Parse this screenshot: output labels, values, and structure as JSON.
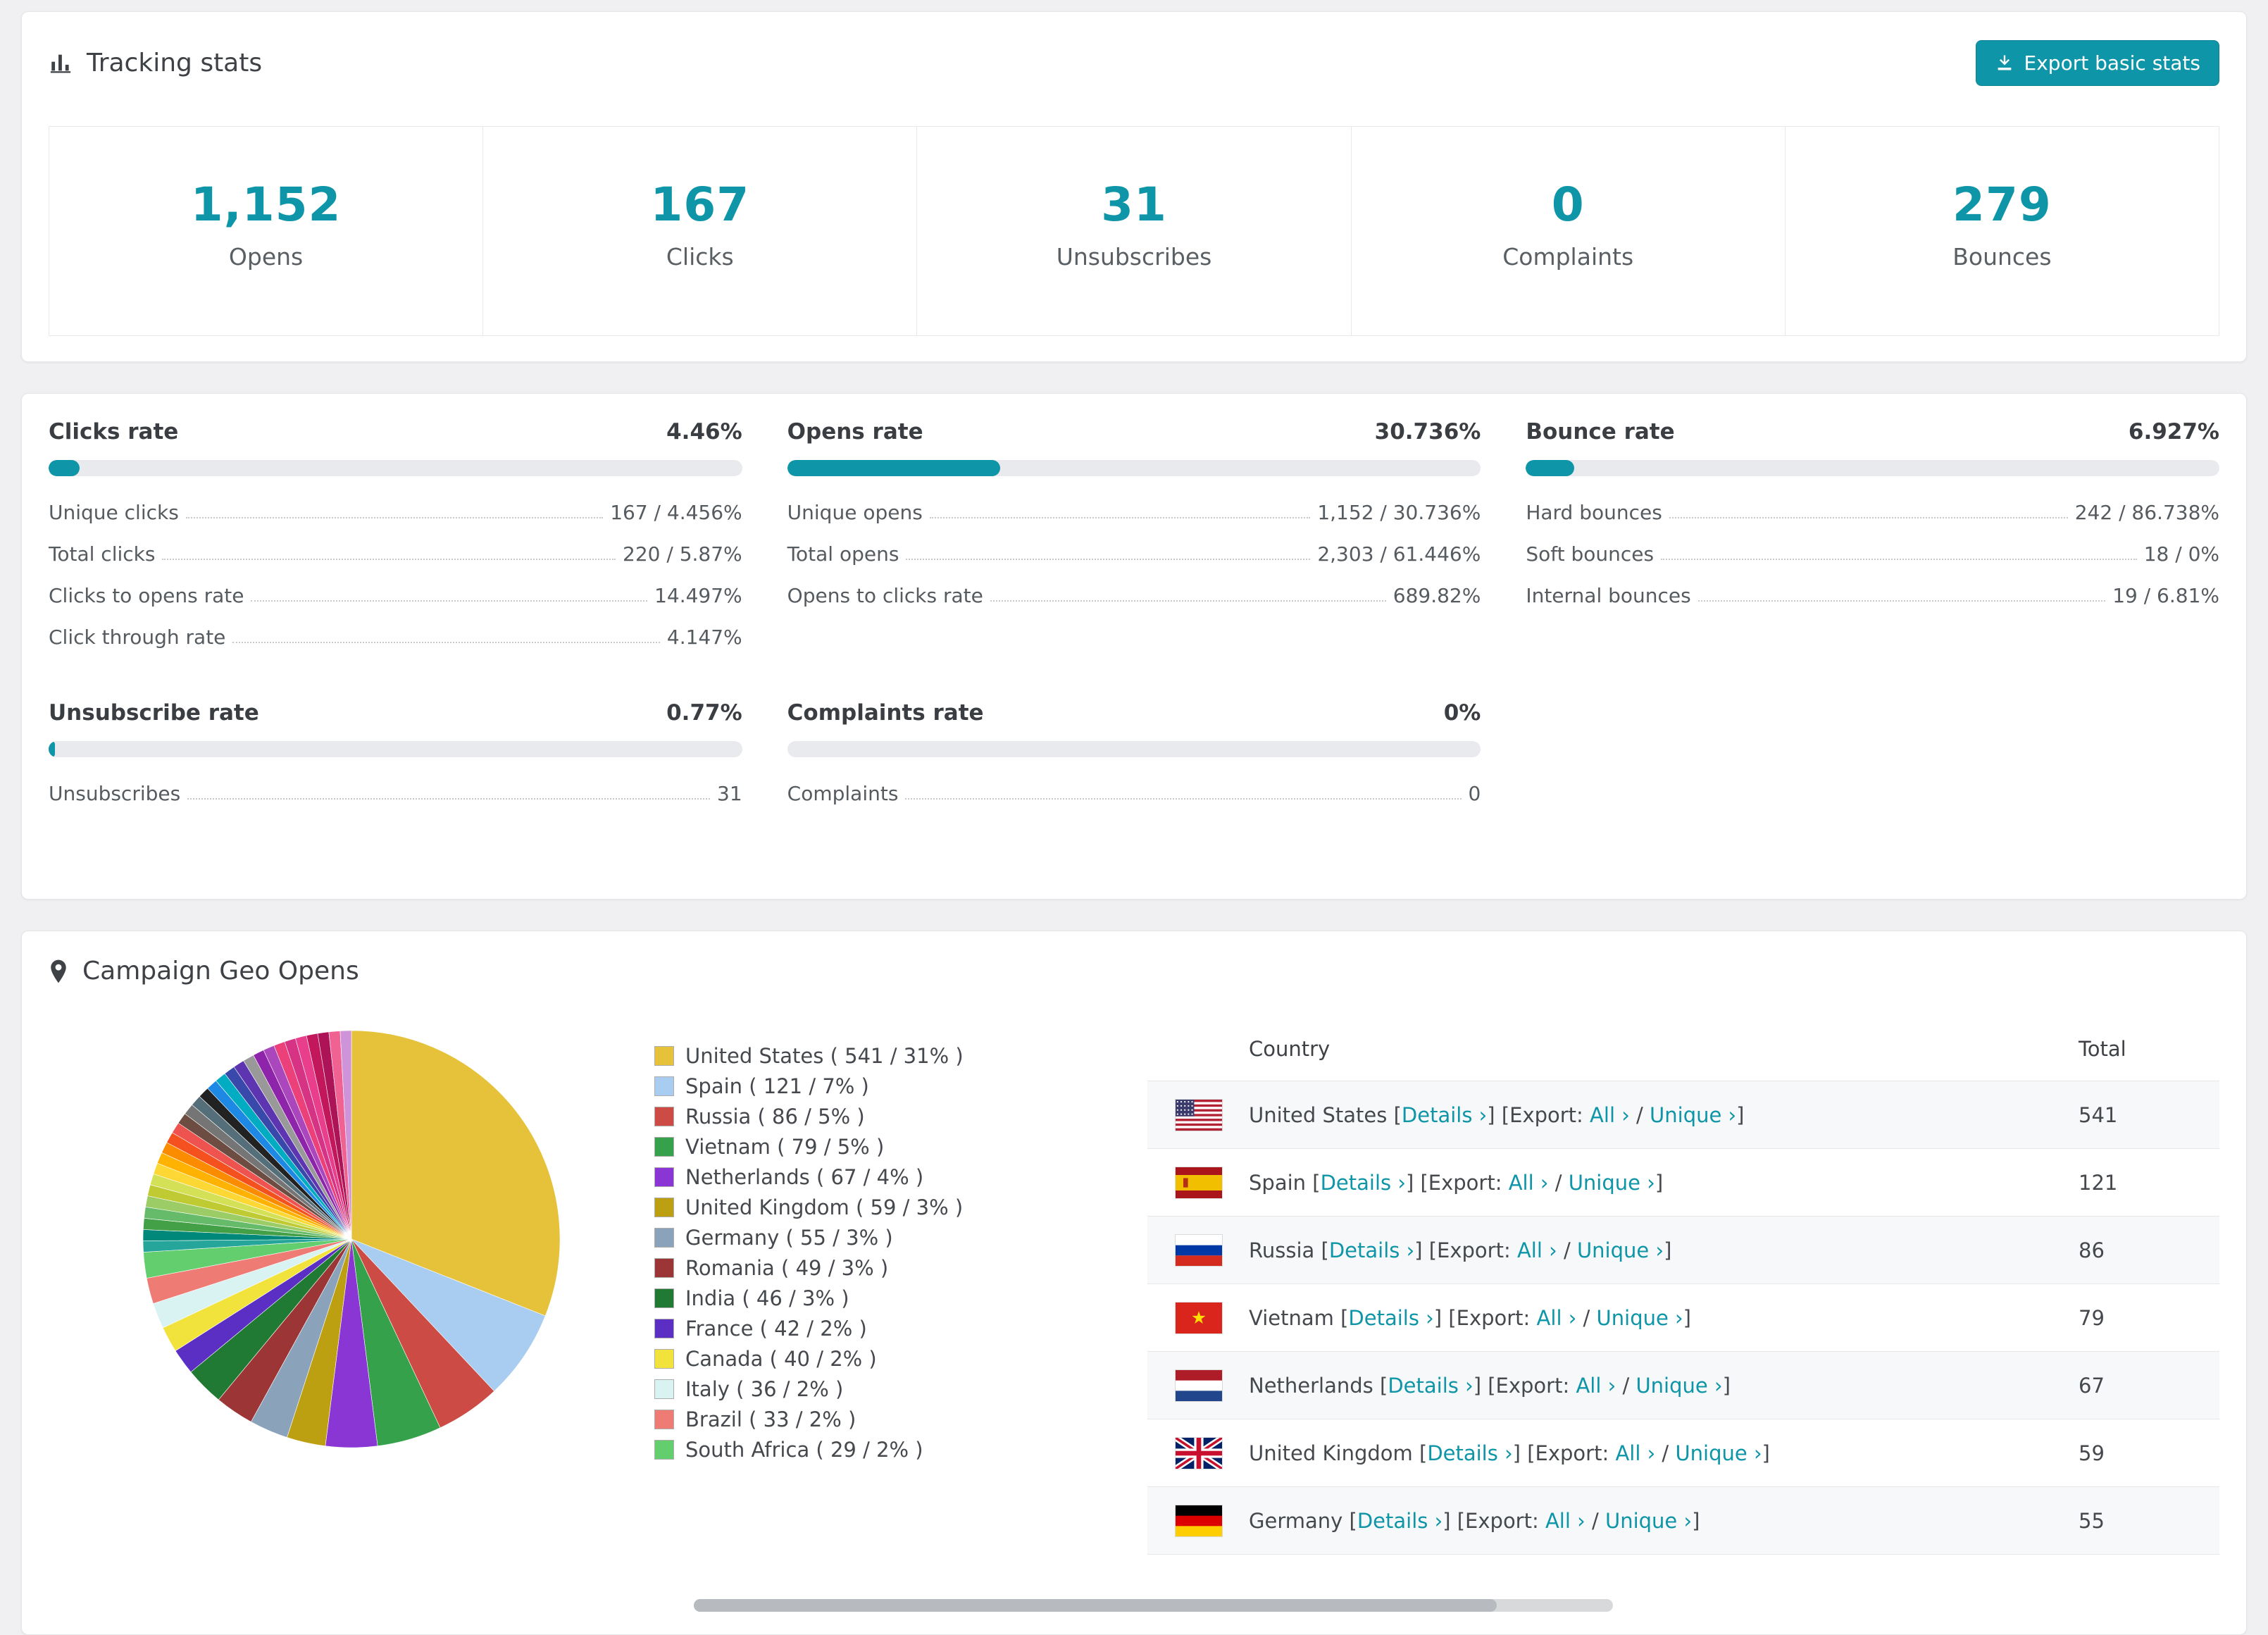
{
  "colors": {
    "accent": "#0e95a8"
  },
  "header": {
    "title": "Tracking stats",
    "export_button": "Export basic stats"
  },
  "summary": [
    {
      "value": "1,152",
      "label": "Opens"
    },
    {
      "value": "167",
      "label": "Clicks"
    },
    {
      "value": "31",
      "label": "Unsubscribes"
    },
    {
      "value": "0",
      "label": "Complaints"
    },
    {
      "value": "279",
      "label": "Bounces"
    }
  ],
  "rates": [
    {
      "title": "Clicks rate",
      "value": "4.46%",
      "pct": 4.46,
      "rows": [
        {
          "label": "Unique clicks",
          "value": "167 / 4.456%"
        },
        {
          "label": "Total clicks",
          "value": "220 / 5.87%"
        },
        {
          "label": "Clicks to opens rate",
          "value": "14.497%"
        },
        {
          "label": "Click through rate",
          "value": "4.147%"
        }
      ]
    },
    {
      "title": "Opens rate",
      "value": "30.736%",
      "pct": 30.736,
      "rows": [
        {
          "label": "Unique opens",
          "value": "1,152 / 30.736%"
        },
        {
          "label": "Total opens",
          "value": "2,303 / 61.446%"
        },
        {
          "label": "Opens to clicks rate",
          "value": "689.82%"
        }
      ]
    },
    {
      "title": "Bounce rate",
      "value": "6.927%",
      "pct": 6.927,
      "rows": [
        {
          "label": "Hard bounces",
          "value": "242 / 86.738%"
        },
        {
          "label": "Soft bounces",
          "value": "18 / 0%"
        },
        {
          "label": "Internal bounces",
          "value": "19 / 6.81%"
        }
      ]
    },
    {
      "title": "Unsubscribe rate",
      "value": "0.77%",
      "pct": 0.77,
      "rows": [
        {
          "label": "Unsubscribes",
          "value": "31"
        }
      ]
    },
    {
      "title": "Complaints rate",
      "value": "0%",
      "pct": 0,
      "rows": [
        {
          "label": "Complaints",
          "value": "0"
        }
      ]
    }
  ],
  "geo": {
    "title": "Campaign Geo Opens",
    "table": {
      "headers": [
        "Country",
        "Total"
      ],
      "links": {
        "details": "Details ›",
        "export": "Export:",
        "all": "All ›",
        "unique": "Unique ›"
      },
      "rows": [
        {
          "country": "United States",
          "flag": "us",
          "total": "541"
        },
        {
          "country": "Spain",
          "flag": "es",
          "total": "121"
        },
        {
          "country": "Russia",
          "flag": "ru",
          "total": "86"
        },
        {
          "country": "Vietnam",
          "flag": "vn",
          "total": "79"
        },
        {
          "country": "Netherlands",
          "flag": "nl",
          "total": "67"
        },
        {
          "country": "United Kingdom",
          "flag": "gb",
          "total": "59"
        },
        {
          "country": "Germany",
          "flag": "de",
          "total": "55"
        }
      ]
    }
  },
  "chart_data": {
    "type": "pie",
    "title": "Campaign Geo Opens",
    "legend_position": "right",
    "slices": [
      {
        "label": "United States",
        "value": 541,
        "pct": 31,
        "color": "#e6c23a"
      },
      {
        "label": "Spain",
        "value": 121,
        "pct": 7,
        "color": "#a8cdf0"
      },
      {
        "label": "Russia",
        "value": 86,
        "pct": 5,
        "color": "#cc4b45"
      },
      {
        "label": "Vietnam",
        "value": 79,
        "pct": 5,
        "color": "#35a24b"
      },
      {
        "label": "Netherlands",
        "value": 67,
        "pct": 4,
        "color": "#8a36d4"
      },
      {
        "label": "United Kingdom",
        "value": 59,
        "pct": 3,
        "color": "#bda012"
      },
      {
        "label": "Germany",
        "value": 55,
        "pct": 3,
        "color": "#8aa2ba"
      },
      {
        "label": "Romania",
        "value": 49,
        "pct": 3,
        "color": "#9c3636"
      },
      {
        "label": "India",
        "value": 46,
        "pct": 3,
        "color": "#217a33"
      },
      {
        "label": "France",
        "value": 42,
        "pct": 2,
        "color": "#5b2fc4"
      },
      {
        "label": "Canada",
        "value": 40,
        "pct": 2,
        "color": "#f2e23c"
      },
      {
        "label": "Italy",
        "value": 36,
        "pct": 2,
        "color": "#d9f3f2"
      },
      {
        "label": "Brazil",
        "value": 33,
        "pct": 2,
        "color": "#ee7b74"
      },
      {
        "label": "South Africa",
        "value": 29,
        "pct": 2,
        "color": "#63ce6e"
      }
    ],
    "others_pct_total": 26,
    "others_colors": [
      "#26a69a",
      "#00897b",
      "#43a047",
      "#66bb6a",
      "#9ccc65",
      "#c0ca33",
      "#d4e157",
      "#fdd835",
      "#ffb300",
      "#fb8c00",
      "#f4511e",
      "#ef5350",
      "#6d4c41",
      "#757575",
      "#546e7a",
      "#222222",
      "#1e88e5",
      "#00acc1",
      "#3949ab",
      "#5e35b1",
      "#999999",
      "#8e24aa",
      "#ab47bc",
      "#ec407a",
      "#d63384",
      "#e83e8c",
      "#c2185b",
      "#ad1457",
      "#f06292",
      "#ce93d8"
    ]
  }
}
